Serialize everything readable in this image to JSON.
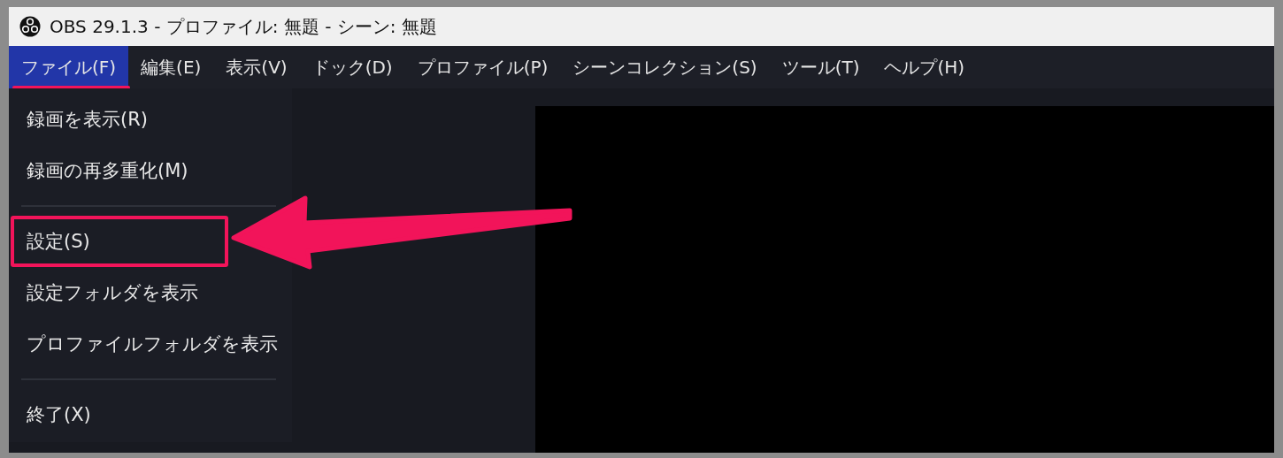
{
  "window": {
    "title": "OBS 29.1.3 - プロファイル: 無題 - シーン: 無題"
  },
  "menubar": [
    {
      "label": "ファイル(F)",
      "selected": true,
      "underlined": true
    },
    {
      "label": "編集(E)",
      "selected": false,
      "underlined": false
    },
    {
      "label": "表示(V)",
      "selected": false,
      "underlined": false
    },
    {
      "label": "ドック(D)",
      "selected": false,
      "underlined": false
    },
    {
      "label": "プロファイル(P)",
      "selected": false,
      "underlined": false
    },
    {
      "label": "シーンコレクション(S)",
      "selected": false,
      "underlined": false
    },
    {
      "label": "ツール(T)",
      "selected": false,
      "underlined": false
    },
    {
      "label": "ヘルプ(H)",
      "selected": false,
      "underlined": false
    }
  ],
  "file_menu": [
    {
      "kind": "item",
      "label": "録画を表示(R)",
      "highlighted": false
    },
    {
      "kind": "item",
      "label": "録画の再多重化(M)",
      "highlighted": false
    },
    {
      "kind": "separator"
    },
    {
      "kind": "item",
      "label": "設定(S)",
      "highlighted": true
    },
    {
      "kind": "item",
      "label": "設定フォルダを表示",
      "highlighted": false
    },
    {
      "kind": "item",
      "label": "プロファイルフォルダを表示",
      "highlighted": false
    },
    {
      "kind": "separator"
    },
    {
      "kind": "item",
      "label": "終了(X)",
      "highlighted": false
    }
  ]
}
